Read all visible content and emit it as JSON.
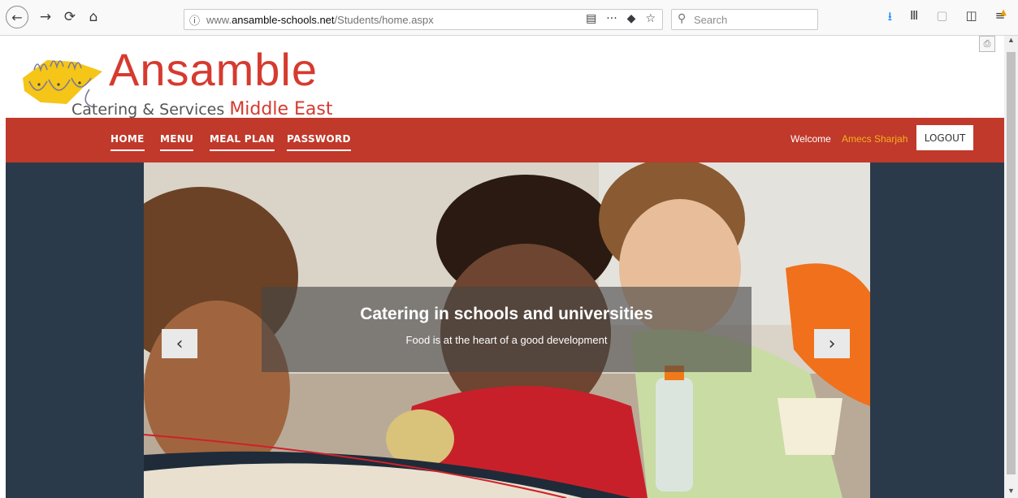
{
  "browser": {
    "back_glyph": "←",
    "forward_glyph": "→",
    "reload_glyph": "⟳",
    "home_glyph": "⌂",
    "url_info_glyph": "ⓘ",
    "url_prefix": "www.",
    "url_host": "ansamble-schools.net",
    "url_path": "/Students/home.aspx",
    "reader_glyph": "▤",
    "more_glyph": "···",
    "pocket_glyph": "◆",
    "bookmark_glyph": "☆",
    "search_glyph": "⚲",
    "search_placeholder": "Search",
    "download_glyph": "⭳",
    "library_glyph": "Ⅲ",
    "sync_glyph": "▢",
    "sidebar_glyph": "◫",
    "menu_glyph": "≡"
  },
  "brand": {
    "name": "Ansamble",
    "tagline": "Catering & Services",
    "region": "Middle East",
    "primary_color": "#c0392b",
    "accent_color": "#f5b21b"
  },
  "nav": {
    "items": [
      {
        "label": "HOME"
      },
      {
        "label": "MENU"
      },
      {
        "label": "MEAL PLAN"
      },
      {
        "label": "PASSWORD"
      }
    ],
    "welcome": "Welcome",
    "username": "Amecs Sharjah",
    "logout": "LOGOUT"
  },
  "hero": {
    "title": "Catering in schools and universities",
    "subtitle": "Food is at the heart of a good development",
    "prev_glyph": "‹",
    "next_glyph": "›"
  }
}
